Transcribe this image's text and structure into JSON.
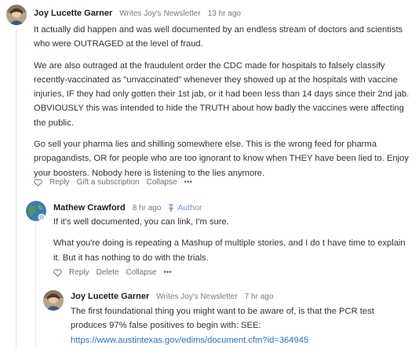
{
  "comments": [
    {
      "author": "Joy Lucette Garner",
      "subtitle": "Writes Joy's Newsletter",
      "time": "13 hr ago",
      "paragraphs": [
        "It actually did happen and was well documented by an endless stream of doctors and scientists who were OUTRAGED at the level of fraud.",
        "We are also outraged at the fraudulent order the CDC made for hospitals to falsely classify recently-vaccinated as \"unvaccinated\" whenever they showed up at the hospitals with vaccine injuries, IF they had only gotten their 1st jab, or it had been less than 14 days since their 2nd jab. OBVIOUSLY this was intended to hide the TRUTH about how badly the vaccines were affecting the public.",
        "Go sell your pharma lies and shilling somewhere else. This is the wrong feed for pharma propagandists, OR for people who are too ignorant to know when THEY have been lied to. Enjoy your boosters. Nobody here is listening to the lies anymore."
      ],
      "actions": [
        "Reply",
        "Gift a subscription",
        "Collapse",
        "•••"
      ]
    },
    {
      "author": "Mathew Crawford",
      "time": "8 hr ago",
      "badge": "Author",
      "paragraphs": [
        "If it's well documented, you can link, I'm sure.",
        "What you're doing is repeating a Mashup of multiple stories, and I do t have time to explain it. But it has nothing to do with the trials."
      ],
      "actions": [
        "Reply",
        "Delete",
        "Collapse",
        "•••"
      ]
    },
    {
      "author": "Joy Lucette Garner",
      "subtitle": "Writes Joy's Newsletter",
      "time": "7 hr ago",
      "text": "The first foundational thing you might want to be aware of, is that the PCR test produces 97% false positives to begin with: SEE:",
      "link": "https://www.austintexas.gov/edims/document.cfm?id=364945"
    }
  ],
  "icons": {
    "like": "heart-icon",
    "badge": "pin-icon",
    "avatar_joy": "person-avatar",
    "avatar_mathew": "globe-avatar"
  },
  "colors": {
    "badge": "#6d8fd6",
    "link": "#2a6fcf",
    "muted": "#7a7a7a"
  }
}
